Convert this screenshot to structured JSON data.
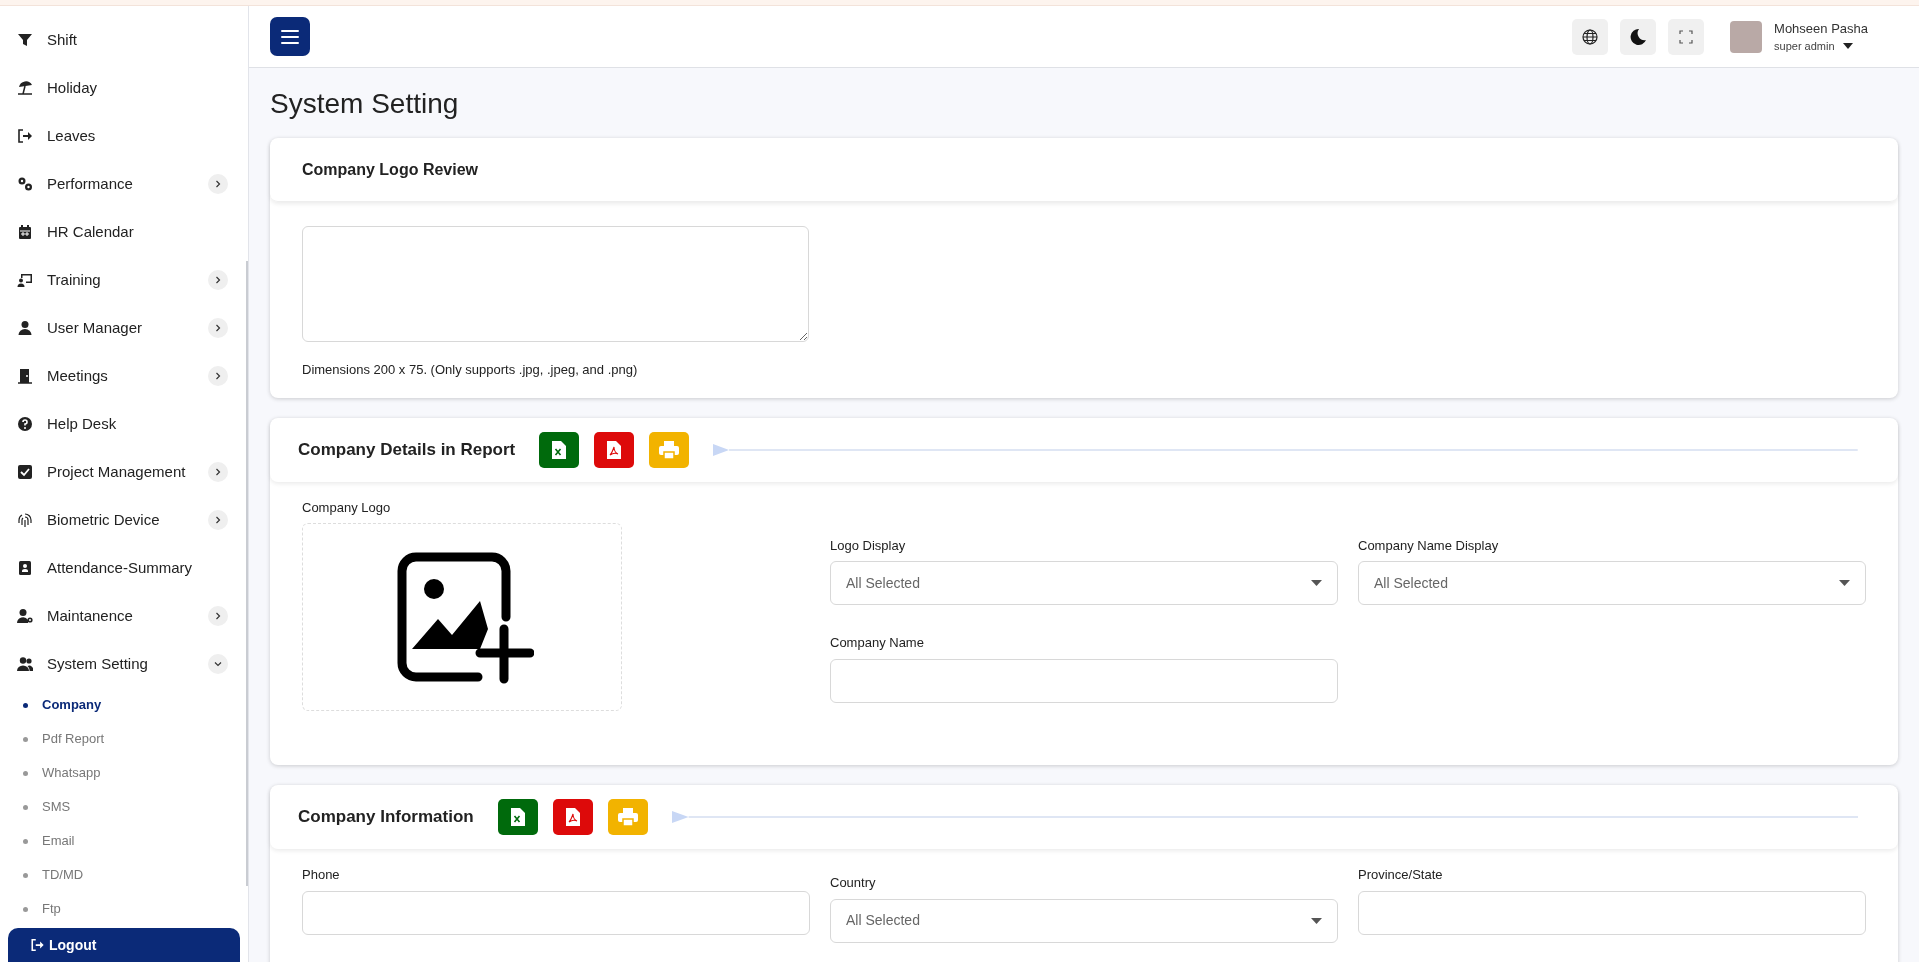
{
  "header": {
    "user_name": "Mohseen Pasha",
    "user_role": "super admin"
  },
  "sidebar": {
    "items": [
      {
        "label": "Shift",
        "kind": "link"
      },
      {
        "label": "Holiday",
        "kind": "link"
      },
      {
        "label": "Leaves",
        "kind": "link"
      },
      {
        "label": "Performance",
        "kind": "group",
        "expanded": false
      },
      {
        "label": "HR Calendar",
        "kind": "link"
      },
      {
        "label": "Training",
        "kind": "group",
        "expanded": false
      },
      {
        "label": "User Manager",
        "kind": "group",
        "expanded": false
      },
      {
        "label": "Meetings",
        "kind": "group",
        "expanded": false
      },
      {
        "label": "Help Desk",
        "kind": "link"
      },
      {
        "label": "Project Management",
        "kind": "group",
        "expanded": false
      },
      {
        "label": "Biometric Device",
        "kind": "group",
        "expanded": false
      },
      {
        "label": "Attendance-Summary",
        "kind": "link"
      },
      {
        "label": "Maintanence",
        "kind": "group",
        "expanded": false
      },
      {
        "label": "System Setting",
        "kind": "group",
        "expanded": true,
        "children": [
          {
            "label": "Company",
            "selected": true
          },
          {
            "label": "Pdf Report",
            "selected": false
          },
          {
            "label": "Whatsapp",
            "selected": false
          },
          {
            "label": "SMS",
            "selected": false
          },
          {
            "label": "Email",
            "selected": false
          },
          {
            "label": "TD/MD",
            "selected": false
          },
          {
            "label": "Ftp",
            "selected": false
          }
        ]
      }
    ],
    "logout": "Logout"
  },
  "page_title": "System Setting",
  "logo_review": {
    "title": "Company Logo Review",
    "hint": "Dimensions 200 x 75. (Only supports .jpg, .jpeg, and .png)"
  },
  "report_details": {
    "title": "Company Details in Report",
    "logo_label": "Company Logo",
    "fields": [
      {
        "label": "Logo Display",
        "kind": "select",
        "value": "All Selected"
      },
      {
        "label": "Company Name Display",
        "kind": "select",
        "value": "All Selected"
      },
      {
        "label": "Company Name",
        "kind": "text"
      }
    ]
  },
  "company_info": {
    "title": "Company Information",
    "fields": [
      {
        "label": "Phone",
        "kind": "text"
      },
      {
        "label": "Country",
        "kind": "select",
        "value": "All Selected"
      },
      {
        "label": "Province/State",
        "kind": "text"
      }
    ]
  }
}
